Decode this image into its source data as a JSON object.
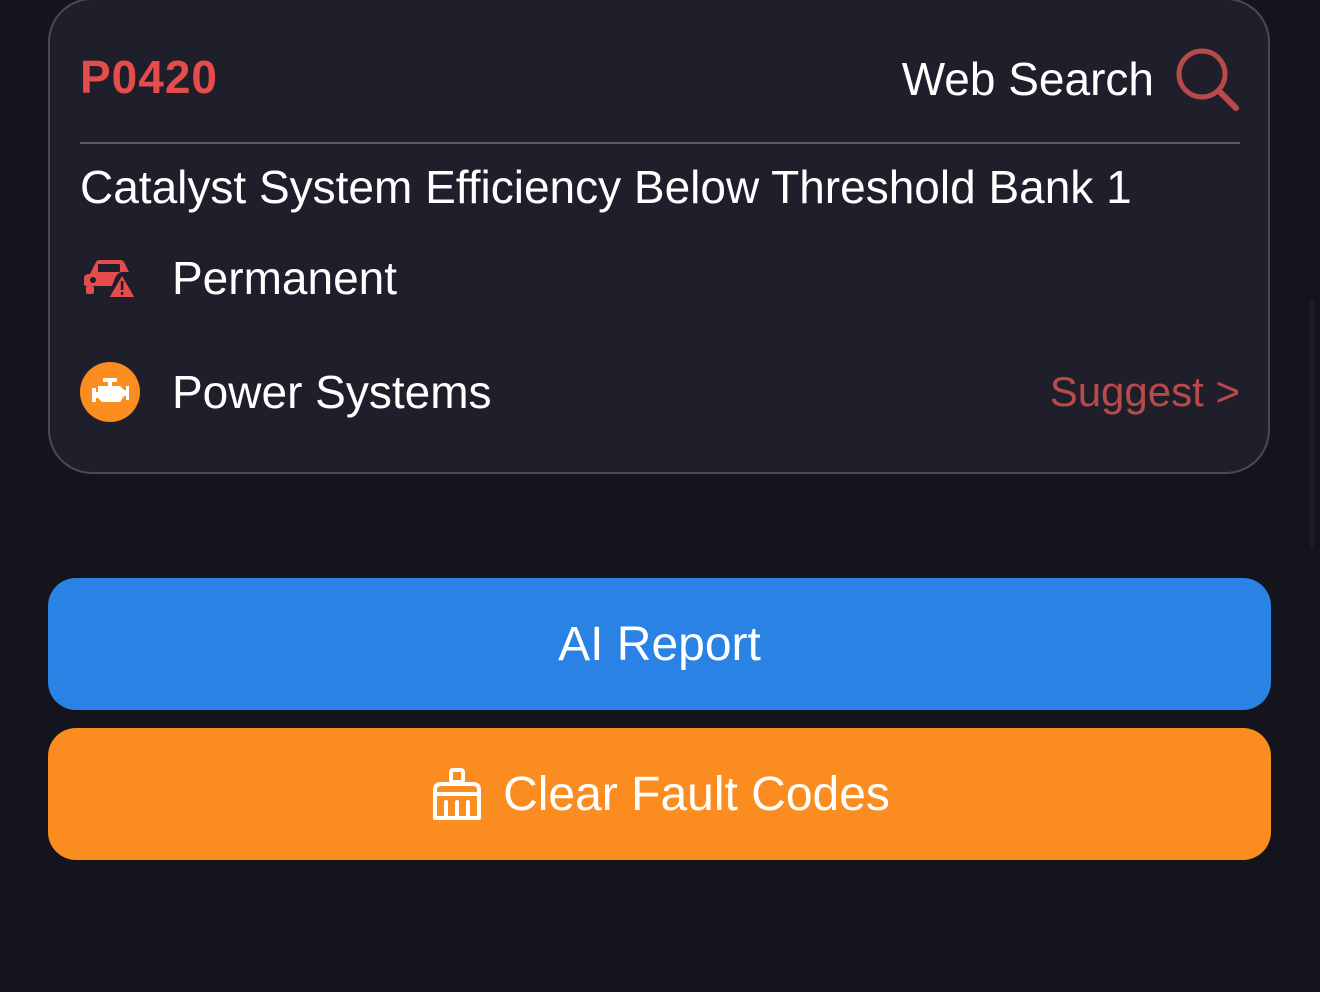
{
  "fault": {
    "code": "P0420",
    "web_search_label": "Web Search",
    "description": "Catalyst System Efficiency Below Threshold Bank 1",
    "status_label": "Permanent",
    "system_label": "Power Systems",
    "suggest_label": "Suggest >"
  },
  "actions": {
    "ai_report_label": "AI Report",
    "clear_codes_label": "Clear Fault Codes"
  },
  "icons": {
    "search": "search-icon",
    "status": "car-warning-icon",
    "system": "engine-icon",
    "clear": "broom-icon"
  },
  "colors": {
    "code": "#e54c4c",
    "ai_button": "#2a82e4",
    "clear_button": "#fb8c1f",
    "suggest": "#b84a4a"
  }
}
